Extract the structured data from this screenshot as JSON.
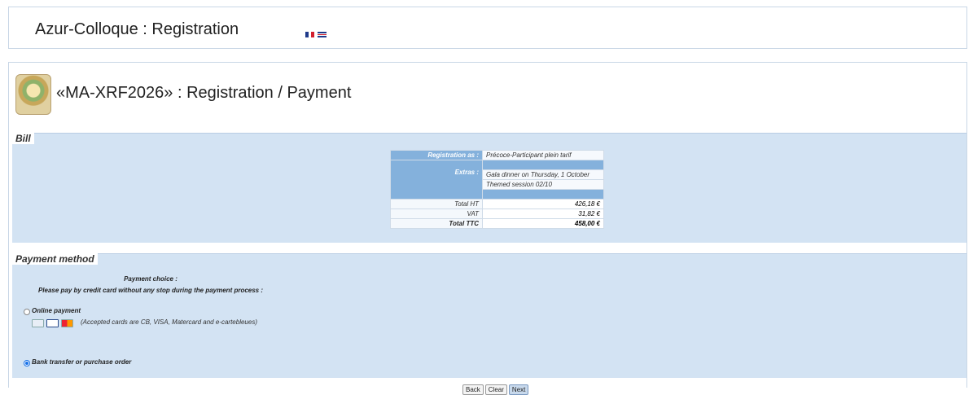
{
  "header": {
    "title": "Azur-Colloque : Registration",
    "flags": [
      "flag-fr-icon",
      "flag-uk-icon"
    ]
  },
  "page": {
    "title": "«MA-XRF2026» : Registration / Payment"
  },
  "bill": {
    "legend": "Bill",
    "registration_label": "Registration as :",
    "registration_value": "Précoce-Participant plein tarif",
    "extras_label": "Extras :",
    "extras": [
      "Gala dinner on Thursday, 1 October",
      "Themed session 02/10"
    ],
    "totals": [
      {
        "label": "Total HT",
        "value": "426,18 €"
      },
      {
        "label": "VAT",
        "value": "31,82 €"
      },
      {
        "label": "Total TTC",
        "value": "458,00 €"
      }
    ]
  },
  "payment": {
    "legend": "Payment method",
    "choice_label": "Payment choice :",
    "instruction": "Please pay by credit card without any stop during the payment process :",
    "online_label": "Online payment",
    "accepted_cards": "(Accepted cards are CB, VISA, Matercard and e-cartebleues)",
    "bank_label": "Bank transfer or purchase order",
    "selected": "bank"
  },
  "buttons": {
    "back": "Back",
    "clear": "Clear",
    "next": "Next"
  },
  "colors": {
    "section_bg": "#d3e3f3",
    "label_bg": "#84b1dc",
    "selected_radio": "#1a73e8"
  }
}
